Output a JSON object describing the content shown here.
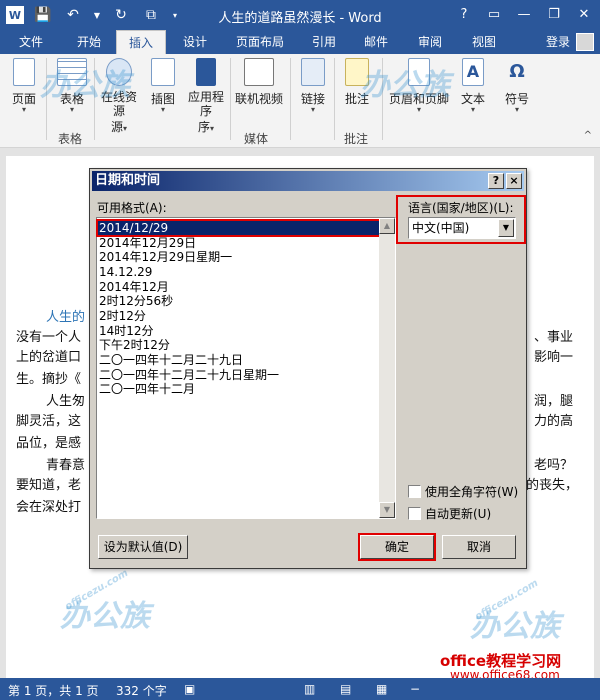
{
  "window": {
    "title": "人生的道路虽然漫长 - Word",
    "login": "登录"
  },
  "tabs": [
    "文件",
    "开始",
    "插入",
    "设计",
    "页面布局",
    "引用",
    "邮件",
    "审阅",
    "视图"
  ],
  "ribbon": {
    "buttons": [
      {
        "label": "页面",
        "icon": "page-icon"
      },
      {
        "label": "表格",
        "icon": "table-icon"
      },
      {
        "label": "在线资源",
        "label2": "源",
        "icon": "online-resource-icon"
      },
      {
        "label": "插图",
        "icon": "illustration-icon"
      },
      {
        "label": "应用程序",
        "label2": "序",
        "icon": "apps-icon"
      },
      {
        "label": "联机视频",
        "icon": "video-icon"
      },
      {
        "label": "链接",
        "icon": "link-icon"
      },
      {
        "label": "批注",
        "icon": "comment-icon"
      },
      {
        "label": "页眉和页脚",
        "icon": "header-footer-icon"
      },
      {
        "label": "文本",
        "icon": "text-icon"
      },
      {
        "label": "符号",
        "icon": "symbol-icon"
      }
    ],
    "groups": [
      "表格",
      "媒体",
      "批注"
    ]
  },
  "document": {
    "lines": [
      "人生的",
      "没有一个人",
      "上的岔道口",
      "生。摘抄《",
      "人生匆",
      "脚灵活，这",
      "品位，是感",
      "青春意",
      "要知道，老",
      "会在深处打"
    ],
    "right_lines": [
      "、事业",
      "影响一",
      "润，腿",
      "力的高",
      "老吗？",
      "的丧失，"
    ]
  },
  "dialog": {
    "title": "日期和时间",
    "help": "?",
    "close": "×",
    "formats_label": "可用格式(A):",
    "formats": [
      "2014/12/29",
      "2014年12月29日",
      "2014年12月29日星期一",
      "14.12.29",
      "2014年12月",
      "2时12分56秒",
      "2时12分",
      "14时12分",
      "下午2时12分",
      "二〇一四年十二月二十九日",
      "二〇一四年十二月二十九日星期一",
      "二〇一四年十二月"
    ],
    "language_label": "语言(国家/地区)(L):",
    "language_value": "中文(中国)",
    "fullwidth_label": "使用全角字符(W)",
    "autoupdate_label": "自动更新(U)",
    "default_button": "设为默认值(D)",
    "ok_button": "确定",
    "cancel_button": "取消"
  },
  "statusbar": {
    "page": "第 1 页，共 1 页",
    "words": "332 个字"
  },
  "watermark": {
    "brand": "办公族",
    "domain": "officezu.com",
    "site": "office教程学习网",
    "site_url": "www.office68.com"
  }
}
